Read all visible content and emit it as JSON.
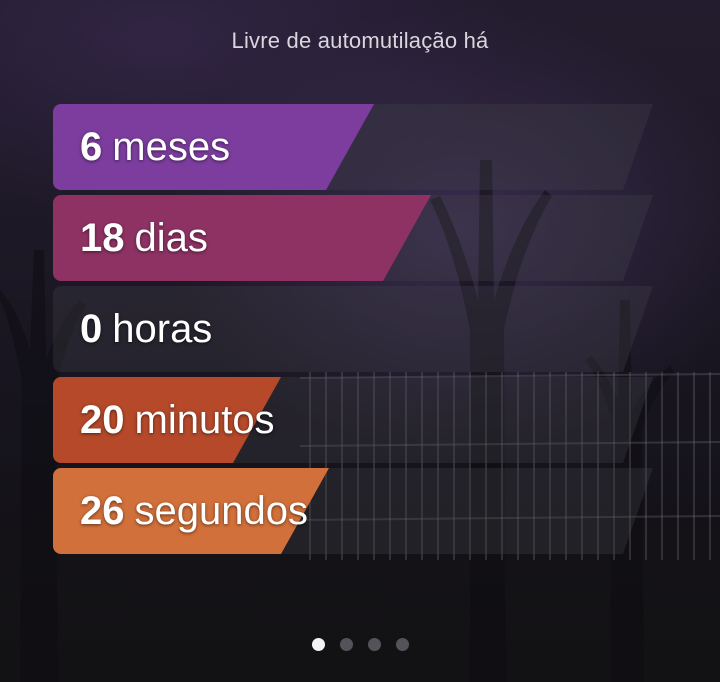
{
  "header": {
    "title": "Livre de automutilação há"
  },
  "counters": [
    {
      "value": "6",
      "unit": "meses",
      "fill": 0.535,
      "color": "#7c3d9e"
    },
    {
      "value": "18",
      "unit": "dias",
      "fill": 0.63,
      "color": "#8e3264"
    },
    {
      "value": "0",
      "unit": "horas",
      "fill": 0.0,
      "color": "#5a5560"
    },
    {
      "value": "20",
      "unit": "minutos",
      "fill": 0.38,
      "color": "#b5492a"
    },
    {
      "value": "26",
      "unit": "segundos",
      "fill": 0.46,
      "color": "#d1703a"
    }
  ],
  "pager": {
    "page_count": 4,
    "active_index": 0
  }
}
